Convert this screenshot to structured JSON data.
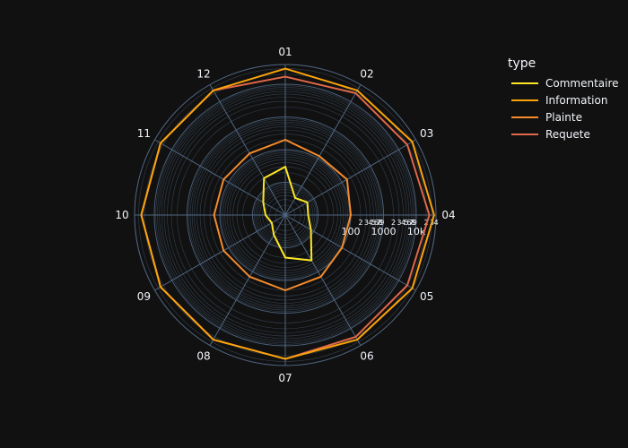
{
  "chart_data": {
    "type": "line",
    "subtype": "polar",
    "radial_axis": {
      "type": "log",
      "range": [
        1,
        40000
      ],
      "major_labels": [
        "100",
        "1000",
        "10k"
      ],
      "minor_labels": [
        "2",
        "3",
        "4",
        "5",
        "6",
        "7",
        "8",
        "9"
      ]
    },
    "angular_axis": {
      "direction": "clockwise",
      "rotation": 90,
      "categories": [
        "01",
        "02",
        "03",
        "04",
        "05",
        "06",
        "07",
        "08",
        "09",
        "10",
        "11",
        "12"
      ]
    },
    "legend": {
      "title": "type",
      "position": "top-right"
    },
    "series": [
      {
        "name": "Commentaire",
        "color": "#fde724",
        "values": [
          30,
          4,
          6,
          5,
          8,
          40,
          20,
          5,
          3,
          4,
          6,
          20
        ]
      },
      {
        "name": "Information",
        "color": "#fba40a",
        "values": [
          30000,
          25000,
          30000,
          35000,
          30000,
          25000,
          25000,
          25000,
          25000,
          25000,
          25000,
          25000
        ]
      },
      {
        "name": "Plainte",
        "color": "#f48c2c",
        "values": [
          200,
          120,
          150,
          100,
          100,
          150,
          200,
          150,
          150,
          150,
          150,
          150
        ]
      },
      {
        "name": "Requete",
        "color": "#e1684b",
        "values": [
          17000,
          20000,
          20000,
          25000,
          20000,
          20000,
          25000,
          25000,
          25000,
          25000,
          25000,
          25000
        ]
      }
    ]
  }
}
